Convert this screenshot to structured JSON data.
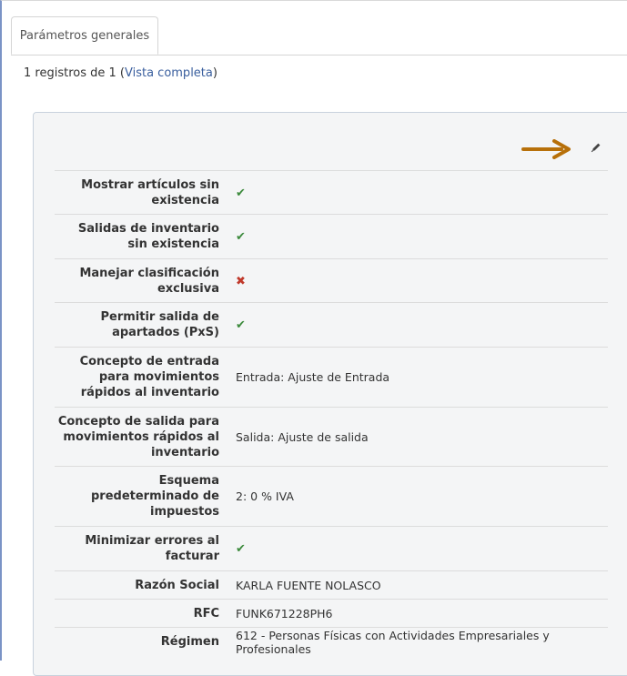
{
  "tabs": [
    {
      "label": "Parámetros generales",
      "active": true
    }
  ],
  "records": {
    "prefix": "1 registros de 1 (",
    "link_label": "Vista completa",
    "suffix": ")"
  },
  "toolbar": {
    "arrow_icon": "arrow-right-icon",
    "edit_icon": "pencil-icon",
    "arrow_color": "#b7700a"
  },
  "colors": {
    "check": "#3c8a3c",
    "cross": "#c0392b",
    "link": "#3a5f9e"
  },
  "params": [
    {
      "label": "Mostrar artículos sin existencia",
      "value": "✔",
      "kind": "check"
    },
    {
      "label": "Salidas de inventario sin existencia",
      "value": "✔",
      "kind": "check"
    },
    {
      "label": "Manejar clasificación exclusiva",
      "value": "✖",
      "kind": "cross"
    },
    {
      "label": "Permitir salida de apartados (PxS)",
      "value": "✔",
      "kind": "check"
    },
    {
      "label": "Concepto de entrada para movimientos rápidos al inventario",
      "value": "Entrada: Ajuste de Entrada",
      "kind": "text"
    },
    {
      "label": "Concepto de salida para movimientos rápidos al inventario",
      "value": "Salida: Ajuste de salida",
      "kind": "text"
    },
    {
      "label": "Esquema predeterminado de impuestos",
      "value": "2: 0 % IVA",
      "kind": "text"
    },
    {
      "label": "Minimizar errores al facturar",
      "value": "✔",
      "kind": "check"
    },
    {
      "label": "Razón Social",
      "value": "KARLA FUENTE NOLASCO",
      "kind": "text"
    },
    {
      "label": "RFC",
      "value": "FUNK671228PH6",
      "kind": "text"
    },
    {
      "label": "Régimen",
      "value": "612 - Personas Físicas con Actividades Empresariales y Profesionales",
      "kind": "text"
    }
  ]
}
